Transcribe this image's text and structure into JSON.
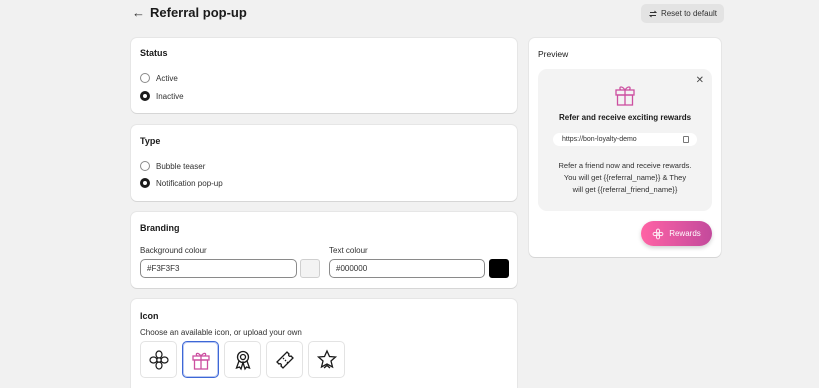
{
  "header": {
    "back_icon": "arrow-left-icon",
    "title": "Referral pop-up",
    "reset_label": "Reset to default",
    "reset_icon": "refresh-icon"
  },
  "status": {
    "title": "Status",
    "options": [
      "Active",
      "Inactive"
    ],
    "selected": "Inactive"
  },
  "type": {
    "title": "Type",
    "options": [
      "Bubble teaser",
      "Notification pop-up"
    ],
    "selected": "Notification pop-up"
  },
  "branding": {
    "title": "Branding",
    "bg_label": "Background colour",
    "bg_value": "#F3F3F3",
    "text_label": "Text colour",
    "text_value": "#000000"
  },
  "icon": {
    "title": "Icon",
    "subtitle": "Choose an available icon, or upload your own",
    "choices": [
      "flower-icon",
      "gift-icon",
      "award-ribbon-icon",
      "ticket-icon",
      "star-badge-icon"
    ],
    "selected": "gift-icon"
  },
  "preview": {
    "title": "Preview",
    "heading": "Refer and receive exciting rewards",
    "url": "https://bon-loyalty-demo",
    "body_1": "Refer a friend now and receive rewards.",
    "body_2": "You will get {{referral_name}} & They",
    "body_3": "will get {{referral_friend_name}}",
    "button_label": "Rewards",
    "accent": "#cc4fa0"
  }
}
